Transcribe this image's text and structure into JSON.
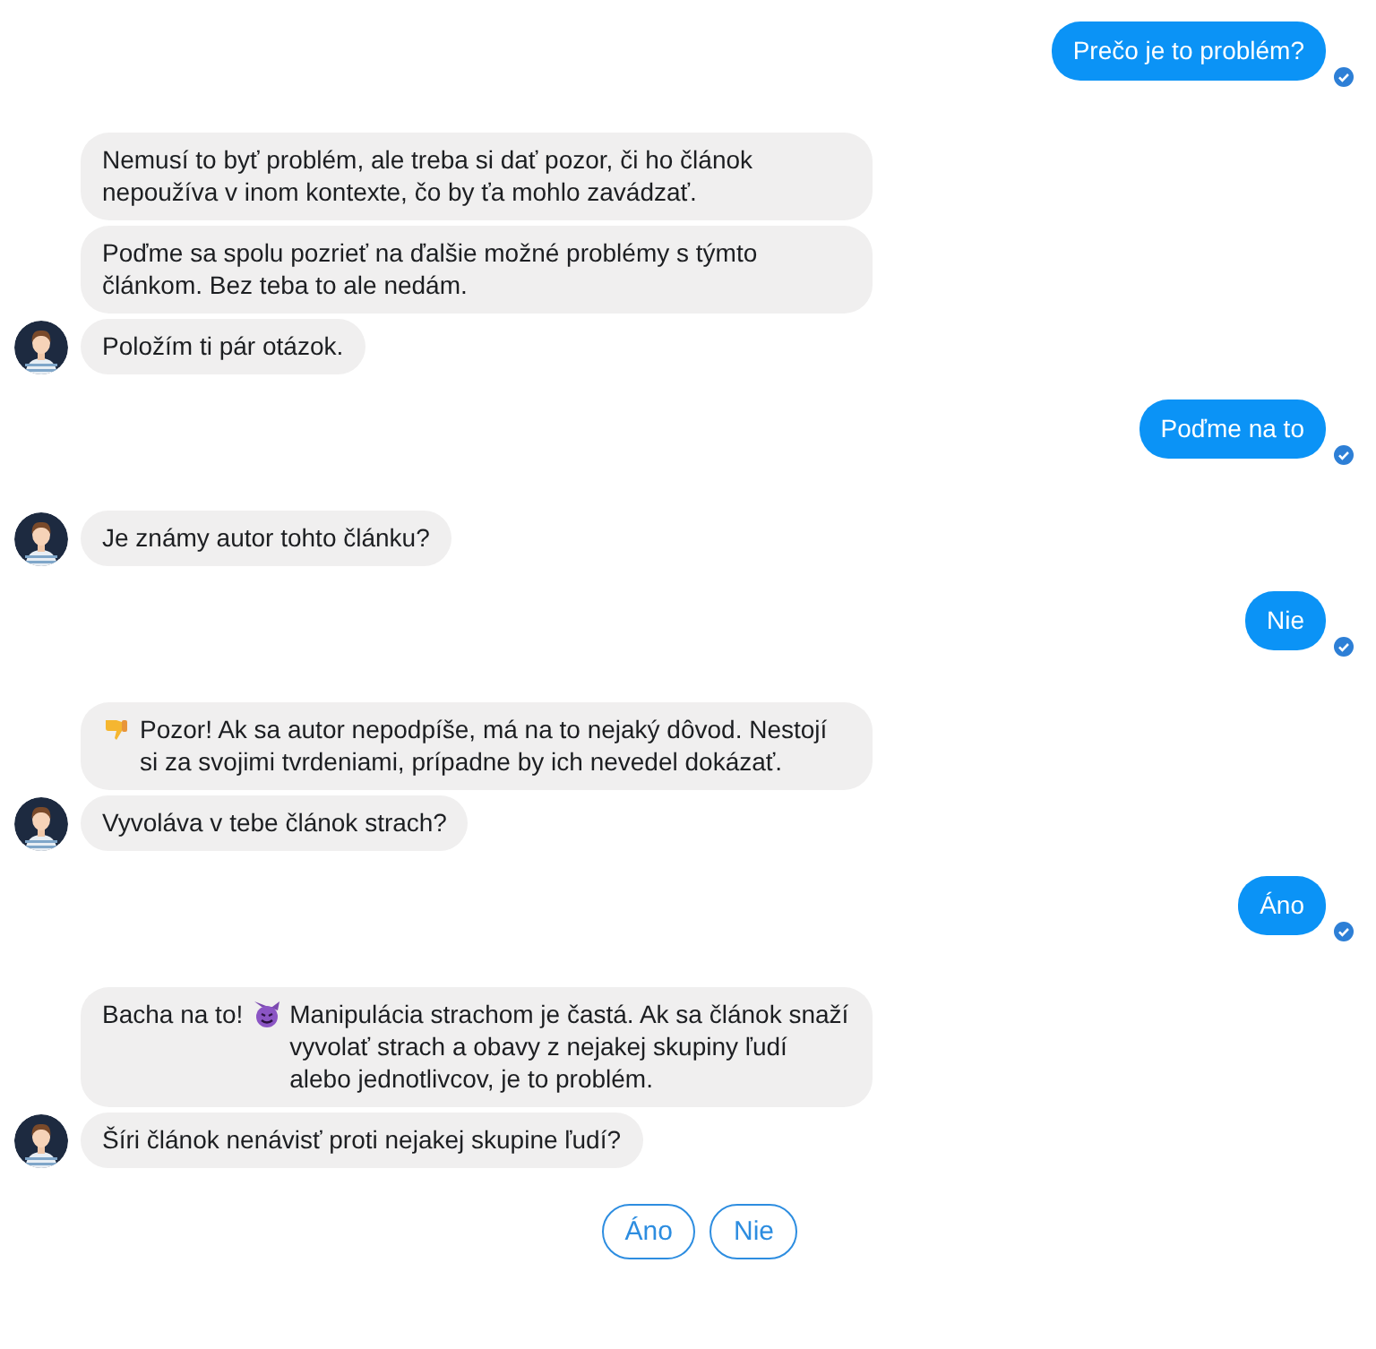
{
  "conversation": [
    {
      "kind": "user",
      "messages": [
        {
          "parts": [
            {
              "kind": "text",
              "text": "Prečo je to problém?"
            }
          ],
          "read": true
        }
      ]
    },
    {
      "kind": "bot",
      "messages": [
        {
          "parts": [
            {
              "kind": "text",
              "text": "Nemusí to byť problém, ale treba si dať pozor, či ho článok nepoužíva v inom kontexte, čo by ťa mohlo zavádzať."
            }
          ]
        },
        {
          "parts": [
            {
              "kind": "text",
              "text": "Poďme sa spolu pozrieť na ďalšie možné problémy s týmto článkom. Bez teba to ale nedám."
            }
          ]
        },
        {
          "parts": [
            {
              "kind": "text",
              "text": "Položím ti pár otázok."
            }
          ]
        }
      ]
    },
    {
      "kind": "user",
      "messages": [
        {
          "parts": [
            {
              "kind": "text",
              "text": "Poďme na to"
            }
          ],
          "read": true
        }
      ]
    },
    {
      "kind": "bot",
      "messages": [
        {
          "parts": [
            {
              "kind": "text",
              "text": "Je známy autor tohto článku?"
            }
          ]
        }
      ]
    },
    {
      "kind": "user",
      "messages": [
        {
          "parts": [
            {
              "kind": "text",
              "text": "Nie"
            }
          ],
          "read": true
        }
      ]
    },
    {
      "kind": "bot",
      "messages": [
        {
          "parts": [
            {
              "kind": "thumbs_down"
            },
            {
              "kind": "text",
              "text": "Pozor! Ak sa autor nepodpíše, má na to nejaký dôvod. Nestojí si za svojimi tvrdeniami, prípadne by ich nevedel dokázať."
            }
          ]
        },
        {
          "parts": [
            {
              "kind": "text",
              "text": "Vyvoláva v tebe článok strach?"
            }
          ]
        }
      ]
    },
    {
      "kind": "user",
      "messages": [
        {
          "parts": [
            {
              "kind": "text",
              "text": "Áno"
            }
          ],
          "read": true
        }
      ]
    },
    {
      "kind": "bot",
      "messages": [
        {
          "parts": [
            {
              "kind": "text",
              "text": "Bacha na to!"
            },
            {
              "kind": "devil"
            },
            {
              "kind": "text",
              "text": "Manipulácia strachom je častá. Ak sa článok snaží vyvolať strach a obavy z nejakej skupiny ľudí alebo jednotlivcov, je to problém."
            }
          ]
        },
        {
          "parts": [
            {
              "kind": "text",
              "text": "Šíri článok nenávisť proti nejakej skupine ľudí?"
            }
          ]
        }
      ]
    }
  ],
  "quick_replies": [
    "Áno",
    "Nie"
  ]
}
